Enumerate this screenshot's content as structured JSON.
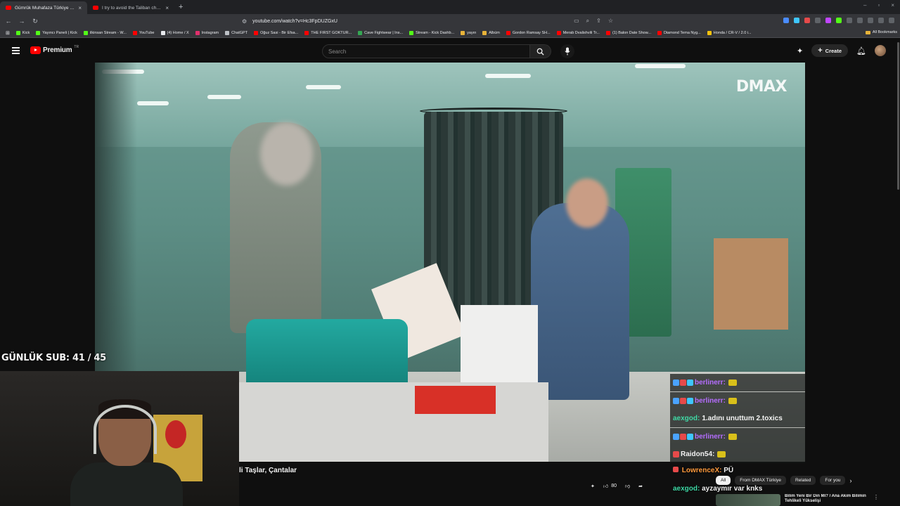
{
  "browser": {
    "tabs": [
      {
        "title": "Gümrük Muhafaza Türkiye 11 -",
        "active": true
      },
      {
        "title": "I try to avoid the Taliban checkpoints",
        "active": false
      }
    ],
    "url": "youtube.com/watch?v=Hc3FpDUZGxU",
    "bookmarks": [
      {
        "label": "Kick",
        "color": "#53fc18"
      },
      {
        "label": "Yayıncı Paneli | Kick",
        "color": "#53fc18"
      },
      {
        "label": "ilkinsan Stream - W...",
        "color": "#53fc18"
      },
      {
        "label": "YouTube",
        "color": "#ff0000"
      },
      {
        "label": "(4) Home / X",
        "color": "#e8eaed"
      },
      {
        "label": "Instagram",
        "color": "#e1306c"
      },
      {
        "label": "ChatGPT",
        "color": "#bdc1c6"
      },
      {
        "label": "Oğuz Sasi - Bir Efsa...",
        "color": "#ff0000"
      },
      {
        "label": "THE FIRST GOKTUR...",
        "color": "#ff0000"
      },
      {
        "label": "Cave Fightwear | Ins...",
        "color": "#34a853"
      },
      {
        "label": "Stream - Kick Dashb...",
        "color": "#53fc18"
      },
      {
        "label": "yayın",
        "color": "#e8b339"
      },
      {
        "label": "Albüm",
        "color": "#e8b339"
      },
      {
        "label": "Gordon Ramsay SH...",
        "color": "#ff0000"
      },
      {
        "label": "Merab Dvalishvili Tr...",
        "color": "#ff0000"
      },
      {
        "label": "(1) Balon Date Show...",
        "color": "#ff0000"
      },
      {
        "label": "Diamond Tema Nyg...",
        "color": "#ff0000"
      },
      {
        "label": "Honda / CR-V / 2.0 i...",
        "color": "#f4c20d"
      }
    ],
    "all_bookmarks": "All Bookmarks"
  },
  "youtube": {
    "logo_text": "Premium",
    "country_code": "TR",
    "search_placeholder": "Search",
    "create_label": "Create"
  },
  "video": {
    "channel_watermark": "DMAX",
    "title_partial": "li Taşlar, Çantalar",
    "like_count": "80"
  },
  "overlay": {
    "sub_counter": "GÜNLÜK SUB: 41 / 45"
  },
  "chat": [
    {
      "user": "berlinerr:",
      "user_color": "#b56dff",
      "text": "",
      "badges": [
        "#4aa3ff",
        "#e64a4a",
        "#3fc6ff"
      ],
      "emote": true
    },
    {
      "user": "berlinerr:",
      "user_color": "#b56dff",
      "text": "",
      "badges": [
        "#4aa3ff",
        "#e64a4a",
        "#3fc6ff"
      ],
      "emote": true
    },
    {
      "user": "aexgod:",
      "user_color": "#3fd9a6",
      "text": "1.adını unuttum 2.toxics",
      "badges": [],
      "emote": false
    },
    {
      "user": "berlinerr:",
      "user_color": "#b56dff",
      "text": "",
      "badges": [
        "#4aa3ff",
        "#e64a4a",
        "#3fc6ff"
      ],
      "emote": true
    },
    {
      "user": "Raidon54:",
      "user_color": "#f1f1f1",
      "text": "",
      "badges": [
        "#e64a4a"
      ],
      "emote": true
    }
  ],
  "floating_chat": [
    {
      "user": "LowrenceX:",
      "user_color": "#ff9a3c",
      "text": "PÜ"
    },
    {
      "user": "aexgod:",
      "user_color": "#3fd9a6",
      "text": "ayzaymır var knks"
    }
  ],
  "chips": [
    {
      "label": "All",
      "active": true
    },
    {
      "label": "From DMAX Türkiye",
      "active": false
    },
    {
      "label": "Related",
      "active": false
    },
    {
      "label": "For you",
      "active": false
    }
  ],
  "recommended": {
    "title": "Bilim Yeni Bir Din Mi? / Ana Akım Bilimin Tehlikeli Yükselişi"
  }
}
